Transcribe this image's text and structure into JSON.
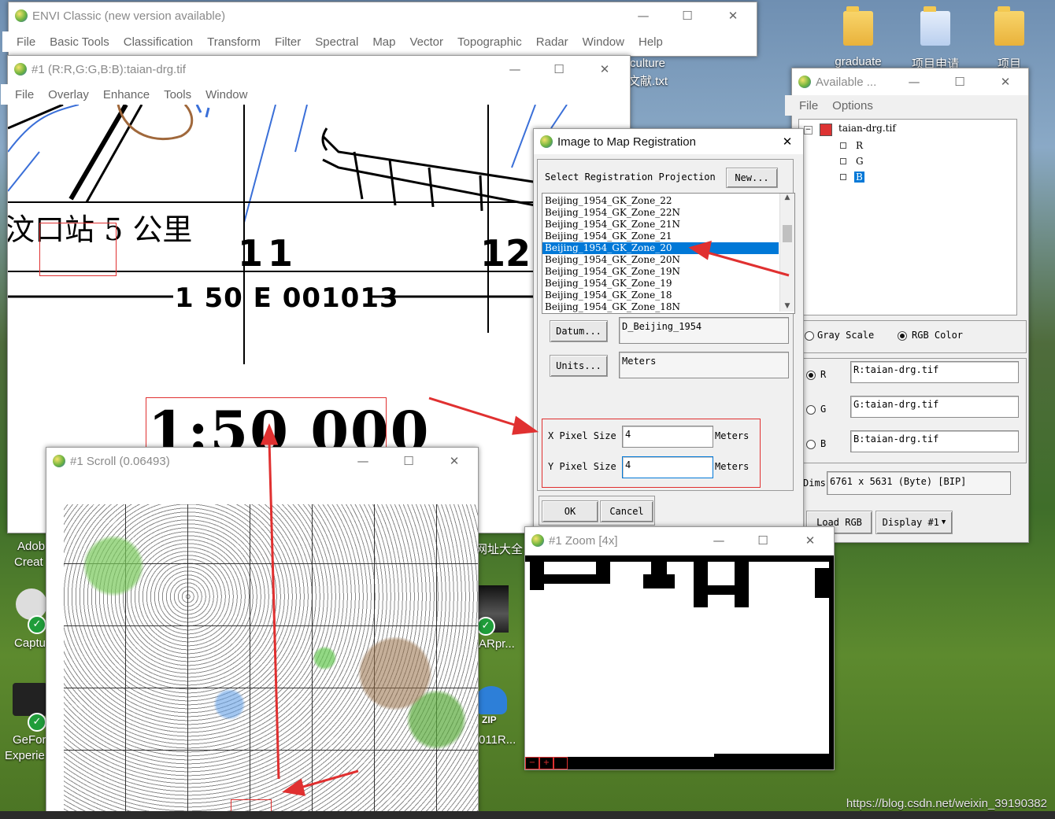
{
  "envi_main": {
    "title": "ENVI Classic (new version available)",
    "menu": [
      "File",
      "Basic Tools",
      "Classification",
      "Transform",
      "Filter",
      "Spectral",
      "Map",
      "Vector",
      "Topographic",
      "Radar",
      "Window",
      "Help"
    ]
  },
  "desktop": {
    "icons_right": [
      "graduate",
      "项目申请",
      "项目"
    ],
    "partial_text": [
      "culture",
      "文献.txt",
      "网址大全",
      "ARpr...",
      "011R...",
      "ZIP"
    ],
    "left_icons": [
      "Adob",
      "Creat",
      "Captu",
      "GeFor",
      "Experie"
    ],
    "watermark": "https://blog.csdn.net/weixin_39190382"
  },
  "image_window": {
    "title": "#1 (R:R,G:G,B:B):taian-drg.tif",
    "menu": [
      "File",
      "Overlay",
      "Enhance",
      "Tools",
      "Window"
    ],
    "map_text": {
      "station": "汶口站 5 公里",
      "grid11": "11",
      "grid12": "12",
      "coord": "1 50 E 001013",
      "scale": "1:50 000"
    }
  },
  "available_bands": {
    "title": "Available ...",
    "menu": [
      "File",
      "Options"
    ],
    "tree_root": "taian-drg.tif",
    "bands": [
      "R",
      "G",
      "B"
    ],
    "mode_gray": "Gray Scale",
    "mode_rgb": "RGB Color",
    "rgb_labels": [
      "R",
      "G",
      "B"
    ],
    "rgb_values": [
      "R:taian-drg.tif",
      "G:taian-drg.tif",
      "B:taian-drg.tif"
    ],
    "dims_label": "Dims",
    "dims_value": "6761 x 5631 (Byte) [BIP]",
    "load_button": "Load RGB",
    "display_button": "Display #1"
  },
  "registration_dialog": {
    "title": "Image to Map Registration",
    "projection_label": "Select Registration Projection",
    "new_button": "New...",
    "projections": [
      "Beijing_1954_GK_Zone_22",
      "Beijing_1954_GK_Zone_22N",
      "Beijing_1954_GK_Zone_21N",
      "Beijing_1954_GK_Zone_21",
      "Beijing_1954_GK_Zone_20",
      "Beijing_1954_GK_Zone_20N",
      "Beijing_1954_GK_Zone_19N",
      "Beijing_1954_GK_Zone_19",
      "Beijing_1954_GK_Zone_18",
      "Beijing_1954_GK_Zone_18N"
    ],
    "selected_index": 4,
    "datum_button": "Datum...",
    "datum_value": "D_Beijing_1954",
    "units_button": "Units...",
    "units_value": "Meters",
    "x_pixel_label": "X Pixel Size",
    "x_pixel_value": "4",
    "x_pixel_unit": "Meters",
    "y_pixel_label": "Y Pixel Size",
    "y_pixel_value": "4",
    "y_pixel_unit": "Meters",
    "ok_button": "OK",
    "cancel_button": "Cancel"
  },
  "scroll_window": {
    "title": "#1 Scroll (0.06493)"
  },
  "zoom_window": {
    "title": "#1 Zoom [4x]"
  },
  "colors": {
    "selection": "#0078d7",
    "annotation_red": "#e03030"
  }
}
